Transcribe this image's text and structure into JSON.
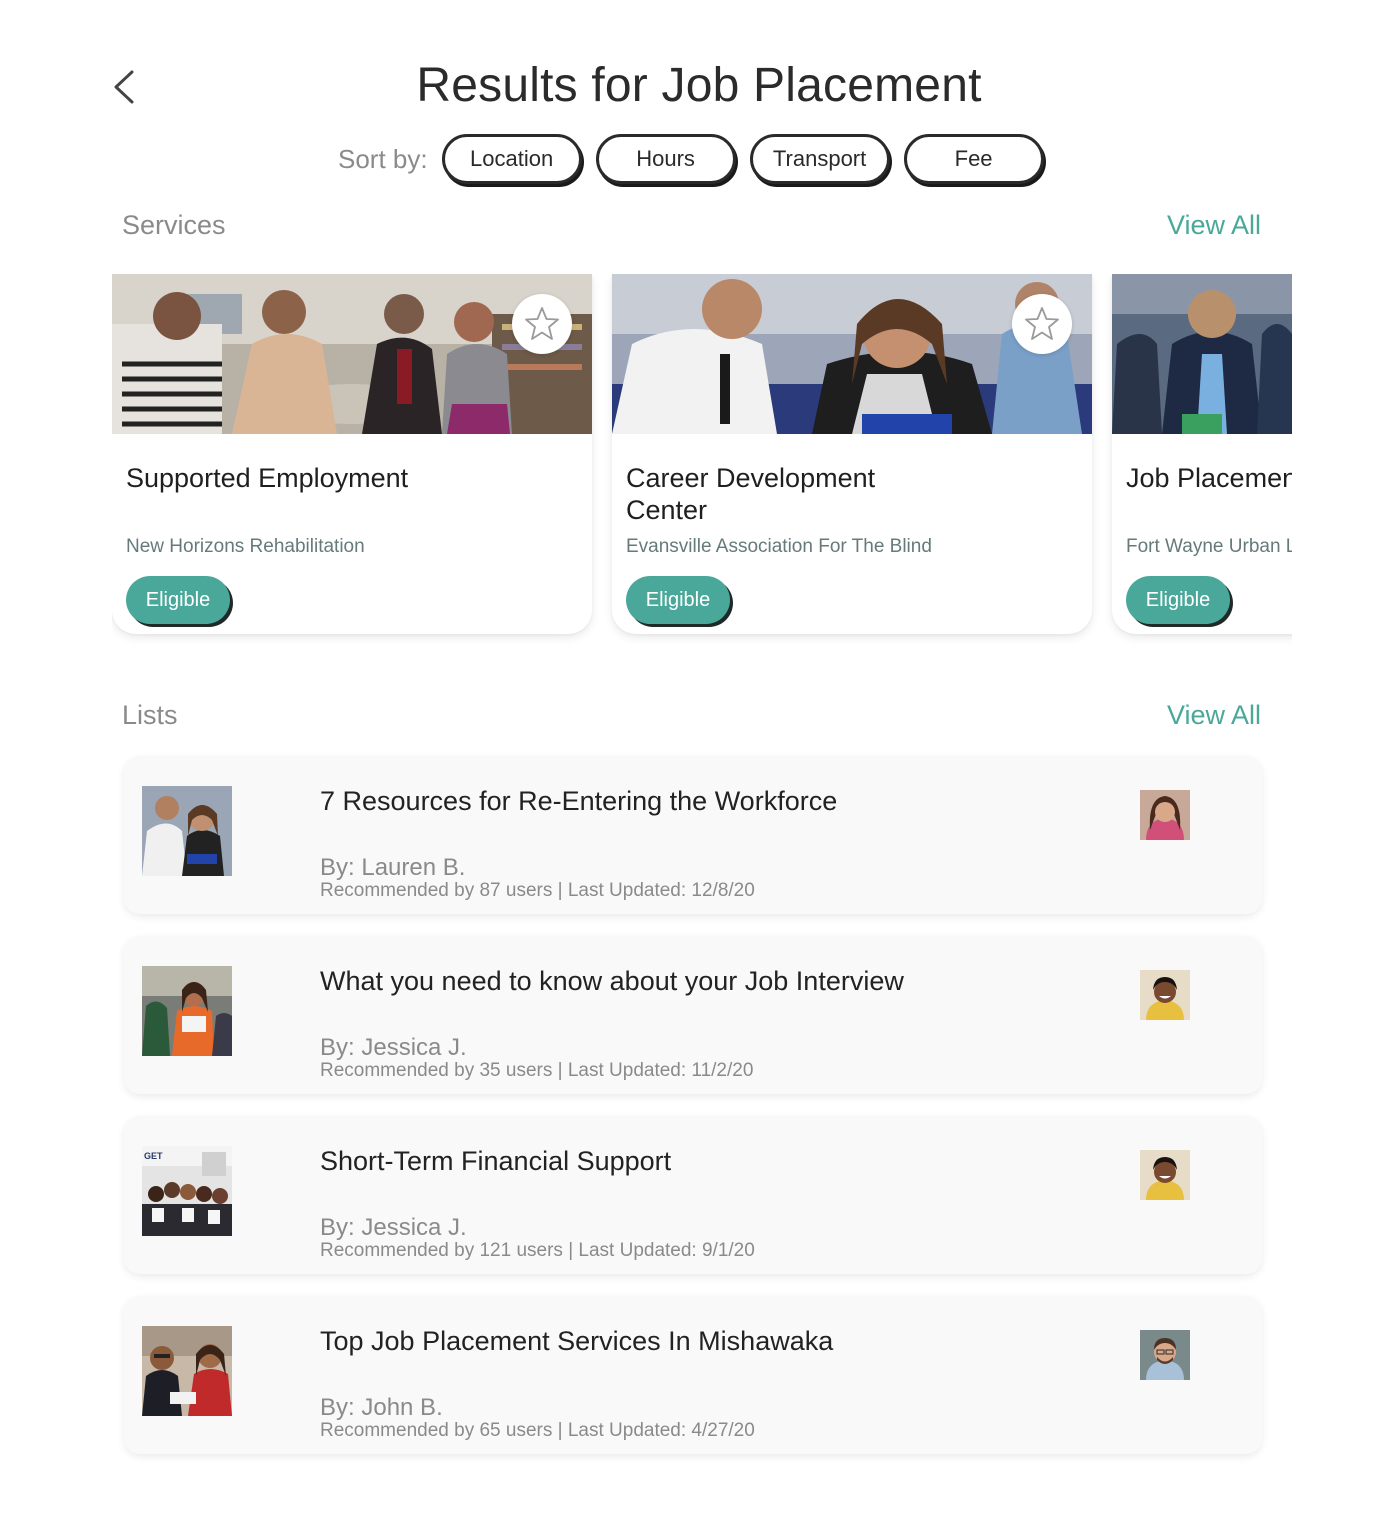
{
  "header": {
    "back_icon": "chevron-left-icon",
    "title": "Results for Job Placement"
  },
  "sort": {
    "label": "Sort by:",
    "options": [
      "Location",
      "Hours",
      "Transport",
      "Fee"
    ]
  },
  "services": {
    "title": "Services",
    "view_all": "View All",
    "cards": [
      {
        "title": "Supported Employment",
        "org": "New Horizons Rehabilitation",
        "badge": "Eligible",
        "favorite_icon": "star-outline-icon"
      },
      {
        "title": "Career Development Center",
        "org": "Evansville Association For The Blind",
        "badge": "Eligible",
        "favorite_icon": "star-outline-icon"
      },
      {
        "title": "Job Placement",
        "org": "Fort Wayne Urban League",
        "badge": "Eligible"
      }
    ]
  },
  "lists": {
    "title": "Lists",
    "view_all": "View All",
    "items": [
      {
        "title": "7 Resources for Re-Entering the Workforce",
        "author": "By: Lauren B.",
        "meta": "Recommended by 87 users | Last Updated: 12/8/20"
      },
      {
        "title": "What you need to know about your Job Interview",
        "author": "By: Jessica J.",
        "meta": "Recommended by 35 users | Last Updated: 11/2/20"
      },
      {
        "title": "Short-Term Financial Support",
        "author": "By: Jessica J.",
        "meta": "Recommended by 121 users | Last Updated: 9/1/20"
      },
      {
        "title": "Top Job Placement Services In Mishawaka",
        "author": "By: John B.",
        "meta": "Recommended by 65 users | Last Updated: 4/27/20"
      }
    ]
  },
  "colors": {
    "accent": "#4aa89a",
    "text_muted": "#8a8a8a",
    "org_text": "#667a7a"
  }
}
